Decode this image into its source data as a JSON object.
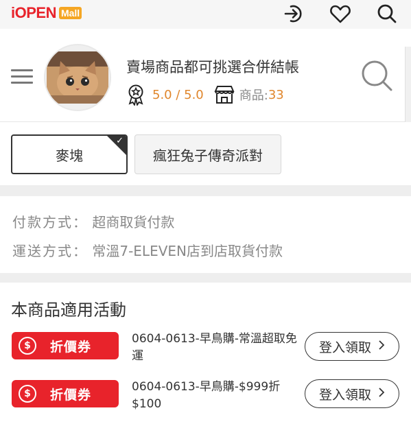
{
  "header": {
    "logo_text": "iOPEN",
    "logo_badge": "Mall",
    "icons": [
      "login-icon",
      "heart-icon",
      "search-icon"
    ]
  },
  "store": {
    "name": "賣場商品都可挑選合併結帳",
    "rating": "5.0 / 5.0",
    "product_count_label": "商品:",
    "product_count": "33",
    "icons": [
      "menu-icon",
      "award-icon",
      "shop-icon",
      "search-icon"
    ]
  },
  "options": [
    {
      "label": "麥塊",
      "selected": true
    },
    {
      "label": "瘋狂兔子傳奇派對",
      "selected": false
    }
  ],
  "info": {
    "payment_label": "付款方式：",
    "payment_value": "超商取貨付款",
    "shipping_label": "運送方式：",
    "shipping_value": "常溫7-ELEVEN店到店取貨付款"
  },
  "events": {
    "title": "本商品適用活動",
    "items": [
      {
        "badge": "折價券",
        "coin": "$",
        "description": "0604-0613-早鳥購-常溫超取免運",
        "action": "登入領取"
      },
      {
        "badge": "折價券",
        "coin": "$",
        "description": "0604-0613-早鳥購-$999折$100",
        "action": "登入領取"
      }
    ]
  },
  "colors": {
    "brand_red": "#e8232b",
    "accent_orange": "#e0862c",
    "mall_badge": "#f5a623"
  }
}
